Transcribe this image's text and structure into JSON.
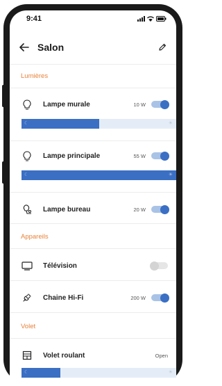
{
  "status": {
    "time": "9:41"
  },
  "header": {
    "title": "Salon",
    "back_icon": "arrow-left-icon",
    "edit_icon": "pencil-icon"
  },
  "sections": {
    "lights": "Lumières",
    "devices": "Appareils",
    "shutter": "Volet"
  },
  "lights": {
    "wall": {
      "label": "Lampe murale",
      "power": "10 W",
      "on": true,
      "brightness": 0.5
    },
    "main": {
      "label": "Lampe principale",
      "power": "55 W",
      "on": true,
      "brightness": 1.0
    },
    "desk": {
      "label": "Lampe bureau",
      "power": "20 W",
      "on": true
    }
  },
  "devices": {
    "tv": {
      "label": "Télévision",
      "on": false
    },
    "hifi": {
      "label": "Chaine Hi-Fi",
      "power": "200 W",
      "on": true
    }
  },
  "shutter": {
    "label": "Volet roulant",
    "status": "Open",
    "position": 0.25
  },
  "colors": {
    "accent": "#3a6fc4",
    "section": "#e8823a"
  }
}
